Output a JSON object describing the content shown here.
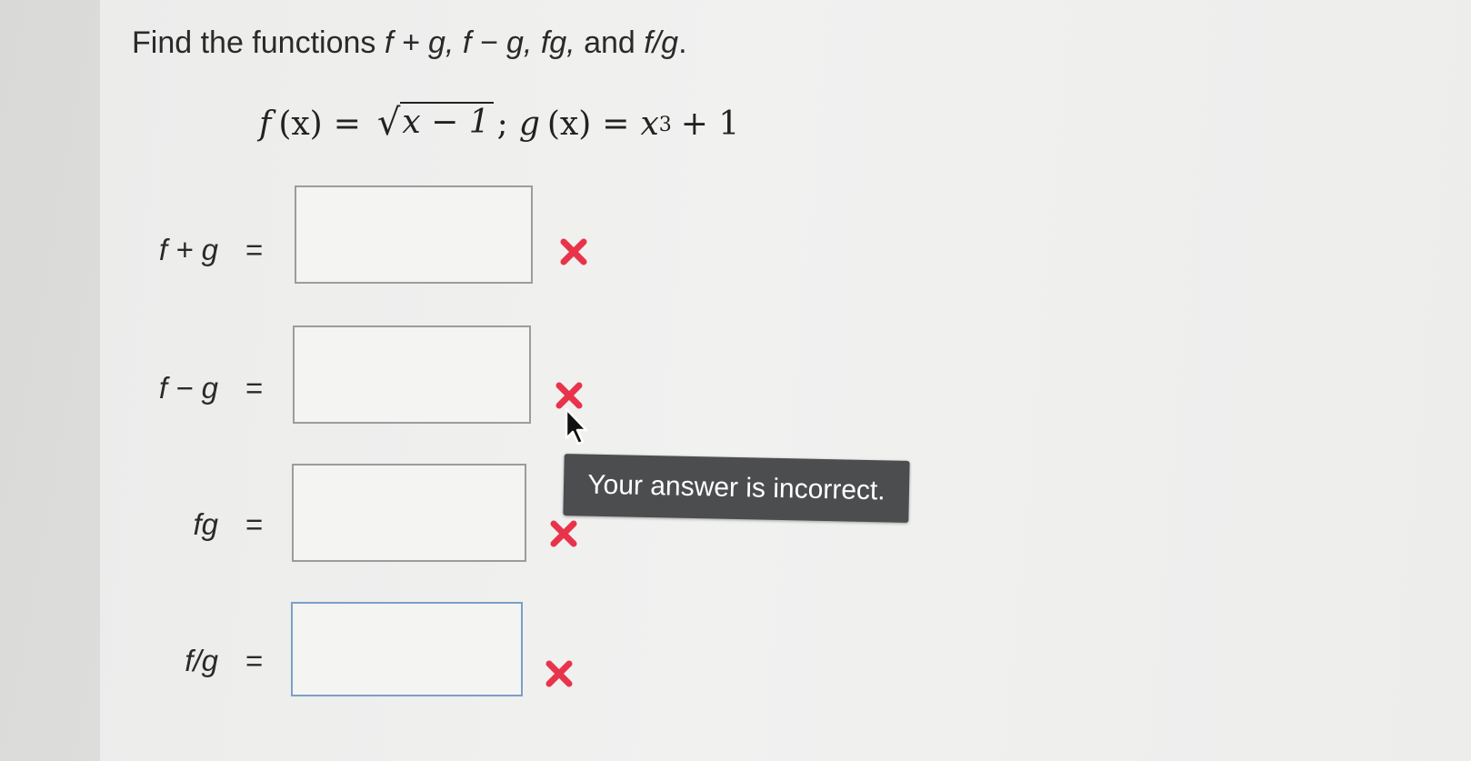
{
  "question": {
    "prompt_prefix": "Find the functions ",
    "prompt_math": "f + g, f − g, fg,",
    "prompt_mid": " and ",
    "prompt_last": "f/g",
    "prompt_end": ".",
    "formula": {
      "f_left": "f",
      "f_arg": "(x)",
      "eq1": "=",
      "radicand": "x − 1",
      "separator": ";",
      "g_left": "g",
      "g_arg": "(x)",
      "eq2": "=",
      "g_base": "x",
      "g_exp": "3",
      "g_tail": "+ 1"
    }
  },
  "rows": [
    {
      "label": "f + g",
      "eq": "=",
      "value": "",
      "status": "incorrect"
    },
    {
      "label": "f − g",
      "eq": "=",
      "value": "",
      "status": "incorrect"
    },
    {
      "label": "fg",
      "eq": "=",
      "value": "",
      "status": "incorrect"
    },
    {
      "label": "f/g",
      "eq": "=",
      "value": "",
      "status": "incorrect"
    }
  ],
  "tooltip": {
    "text": "Your answer is incorrect."
  },
  "colors": {
    "error": "#e8344a",
    "tooltip_bg": "#4b4d4f"
  },
  "icons": {
    "incorrect": "x-icon",
    "pointer": "cursor-icon"
  }
}
